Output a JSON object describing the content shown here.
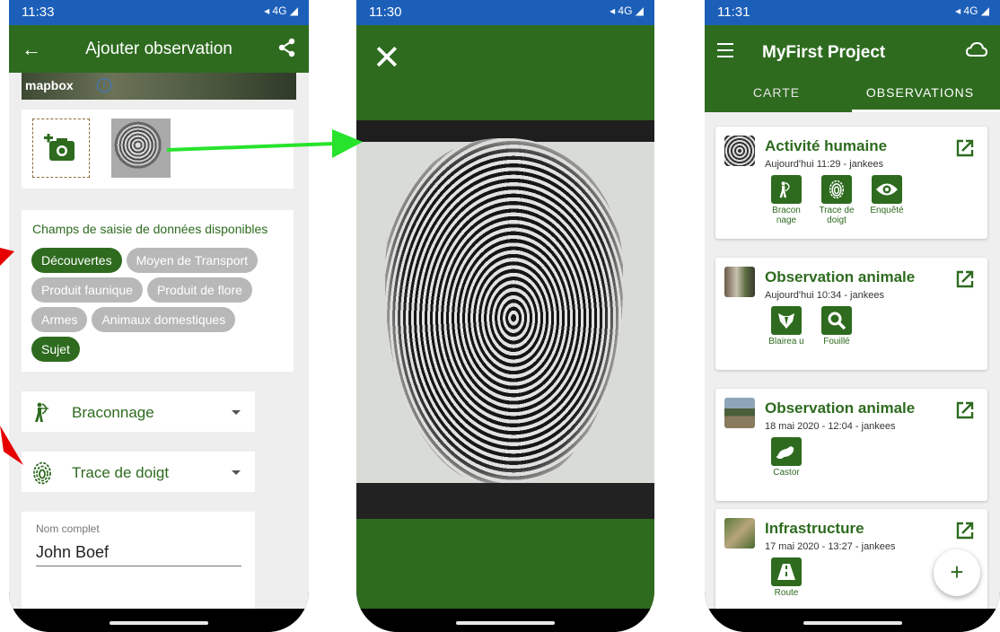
{
  "phone1": {
    "status_time": "11:33",
    "status_icons": "◂ 4G ◢",
    "title": "Ajouter observation",
    "map_logo": "mapbox",
    "map_info": "i",
    "fields_title": "Champs de saisie de données disponibles",
    "chips": [
      {
        "label": "Découvertes",
        "on": true
      },
      {
        "label": "Moyen de Transport",
        "on": false
      },
      {
        "label": "Produit faunique",
        "on": false
      },
      {
        "label": "Produit de flore",
        "on": false
      },
      {
        "label": "Armes",
        "on": false
      },
      {
        "label": "Animaux domestiques",
        "on": false
      },
      {
        "label": "Sujet",
        "on": true
      }
    ],
    "select1": "Braconnage",
    "select2": "Trace de doigt",
    "name_label": "Nom complet",
    "name_value": "John Boef"
  },
  "phone2": {
    "status_time": "11:30",
    "status_icons": "◂ 4G ◢",
    "close": "✕"
  },
  "phone3": {
    "status_time": "11:31",
    "status_icons": "◂ 4G ◢",
    "title": "MyFirst Project",
    "tabs": [
      "CARTE",
      "OBSERVATIONS"
    ],
    "observations": [
      {
        "title": "Activité humaine",
        "date": "Aujourd'hui 11:29 - jankees",
        "tags": [
          "Bracon nage",
          "Trace de doigt",
          "Enquêté"
        ]
      },
      {
        "title": "Observation animale",
        "date": "Aujourd'hui 10:34 - jankees",
        "tags": [
          "Blairea u",
          "Fouillé"
        ]
      },
      {
        "title": "Observation animale",
        "date": "18 mai 2020 - 12:04 - jankees",
        "tags": [
          "Castor"
        ]
      },
      {
        "title": "Infrastructure",
        "date": "17 mai 2020 - 13:27 - jankees",
        "tags": [
          "Route"
        ]
      }
    ],
    "fab": "+"
  },
  "colors": {
    "primary": "#2e6b1f",
    "status_bar": "#1c5fb8",
    "chip_off": "#b8b8b8",
    "arrow_green": "#27e32b",
    "arrow_red": "#e60000"
  }
}
